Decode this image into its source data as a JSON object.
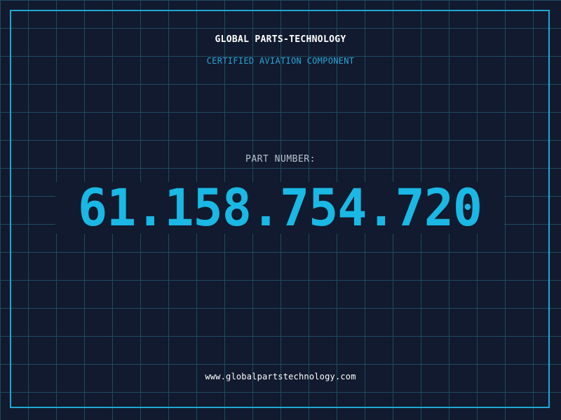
{
  "header": {
    "company": "GLOBAL PARTS-TECHNOLOGY",
    "tagline": "CERTIFIED AVIATION COMPONENT"
  },
  "part": {
    "label": "PART NUMBER:",
    "number": "61.158.754.720"
  },
  "footer": {
    "website": "www.globalpartstechnology.com"
  },
  "colors": {
    "background": "#111a2e",
    "grid": "#1c4b5f",
    "frame": "#1fa7d4",
    "accent": "#1ab8e4",
    "label": "#b9c3cf",
    "text": "#ffffff"
  }
}
